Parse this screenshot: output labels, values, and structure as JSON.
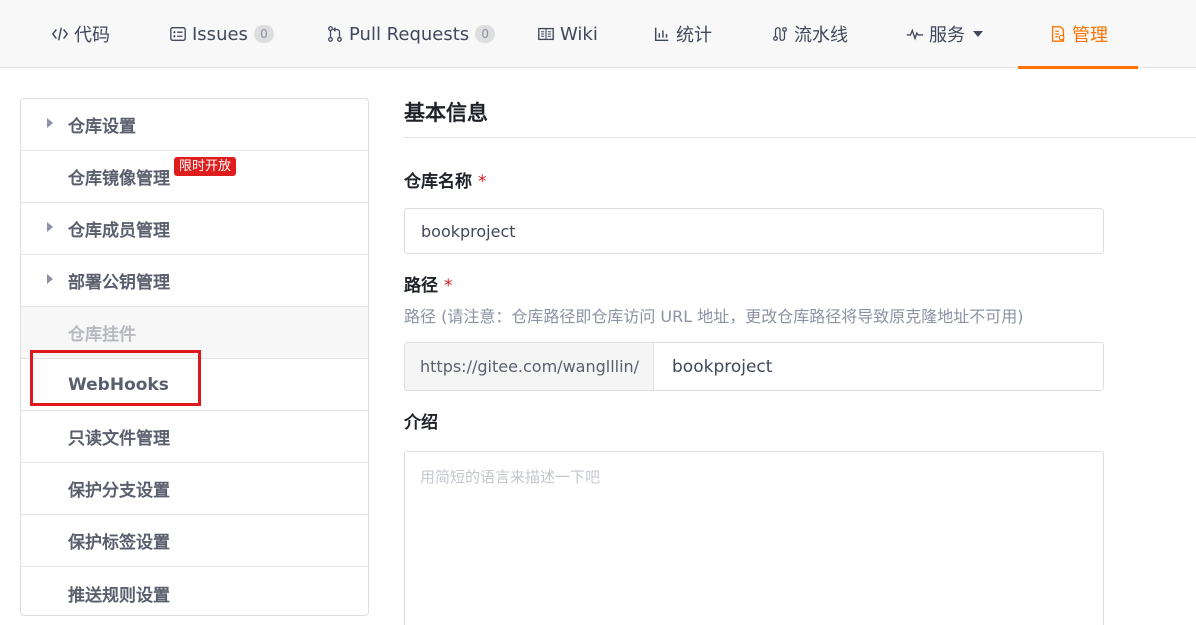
{
  "nav": {
    "tabs": [
      {
        "label": "代码",
        "icon": "code-icon"
      },
      {
        "label": "Issues",
        "icon": "issues-icon",
        "count": "0"
      },
      {
        "label": "Pull Requests",
        "icon": "pull-request-icon",
        "count": "0"
      },
      {
        "label": "Wiki",
        "icon": "book-icon"
      },
      {
        "label": "统计",
        "icon": "bar-chart-icon"
      },
      {
        "label": "流水线",
        "icon": "pipeline-icon"
      },
      {
        "label": "服务",
        "icon": "pulse-icon"
      },
      {
        "label": "管理",
        "icon": "manage-icon"
      }
    ],
    "active_tab": "管理",
    "accent_color": "#fe7300"
  },
  "sidebar": {
    "items": [
      {
        "label": "仓库设置",
        "expandable": true
      },
      {
        "label": "仓库镜像管理",
        "badge": "限时开放"
      },
      {
        "label": "仓库成员管理",
        "expandable": true
      },
      {
        "label": "部署公钥管理",
        "expandable": true
      },
      {
        "label": "仓库挂件",
        "disabled": true
      },
      {
        "label": "WebHooks",
        "highlighted": true
      },
      {
        "label": "只读文件管理"
      },
      {
        "label": "保护分支设置"
      },
      {
        "label": "保护标签设置"
      },
      {
        "label": "推送规则设置"
      }
    ],
    "highlight_color": "#e0181e"
  },
  "main": {
    "section_title": "基本信息",
    "repo_name": {
      "label": "仓库名称",
      "required_mark": "*",
      "value": "bookproject"
    },
    "path": {
      "label": "路径",
      "required_mark": "*",
      "hint": "路径 (请注意：仓库路径即仓库访问 URL 地址，更改仓库路径将导致原克隆地址不可用)",
      "prefix": "https://gitee.com/wanglllin/",
      "value": "bookproject"
    },
    "intro": {
      "label": "介绍",
      "placeholder": "用简短的语言来描述一下吧"
    }
  }
}
